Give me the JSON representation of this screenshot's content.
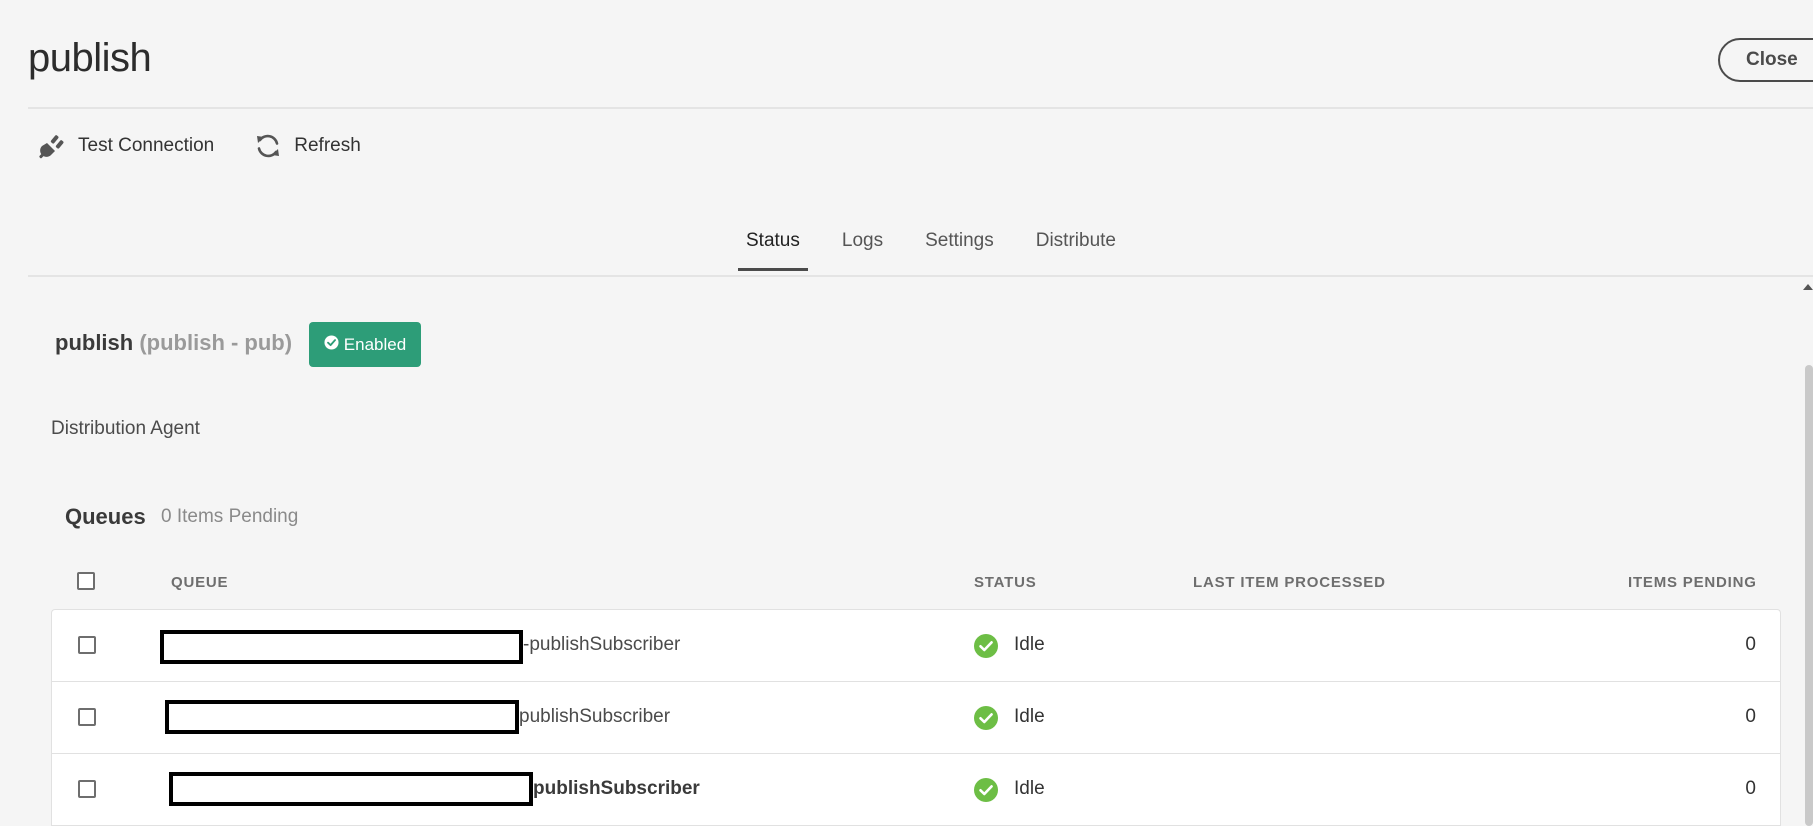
{
  "page": {
    "title": "publish",
    "close_label": "Close"
  },
  "toolbar": {
    "test_connection_label": "Test Connection",
    "refresh_label": "Refresh"
  },
  "tabs": [
    {
      "label": "Status",
      "active": true
    },
    {
      "label": "Logs",
      "active": false
    },
    {
      "label": "Settings",
      "active": false
    },
    {
      "label": "Distribute",
      "active": false
    }
  ],
  "agent": {
    "name": "publish",
    "subtitle": "(publish - pub)",
    "badge_label": "Enabled",
    "badge_color": "#2d9d78",
    "type": "Distribution Agent"
  },
  "queues": {
    "title": "Queues",
    "pending_summary": "0 Items Pending",
    "columns": {
      "queue": "QUEUE",
      "status": "STATUS",
      "last_item": "LAST ITEM PROCESSED",
      "pending": "ITEMS PENDING"
    },
    "rows": [
      {
        "queue_suffix": "-publishSubscriber",
        "status": "Idle",
        "last_item": "",
        "pending": "0"
      },
      {
        "queue_suffix": "publishSubscriber",
        "status": "Idle",
        "last_item": "",
        "pending": "0"
      },
      {
        "queue_suffix": "publishSubscriber",
        "status": "Idle",
        "last_item": "",
        "pending": "0"
      }
    ]
  },
  "colors": {
    "idle_status": "#6dbe45",
    "enabled_badge": "#2d9d78"
  },
  "icons": {
    "test_connection": "plug-icon",
    "refresh": "refresh-icon",
    "badge": "check-circle-icon",
    "status": "check-circle-icon"
  }
}
